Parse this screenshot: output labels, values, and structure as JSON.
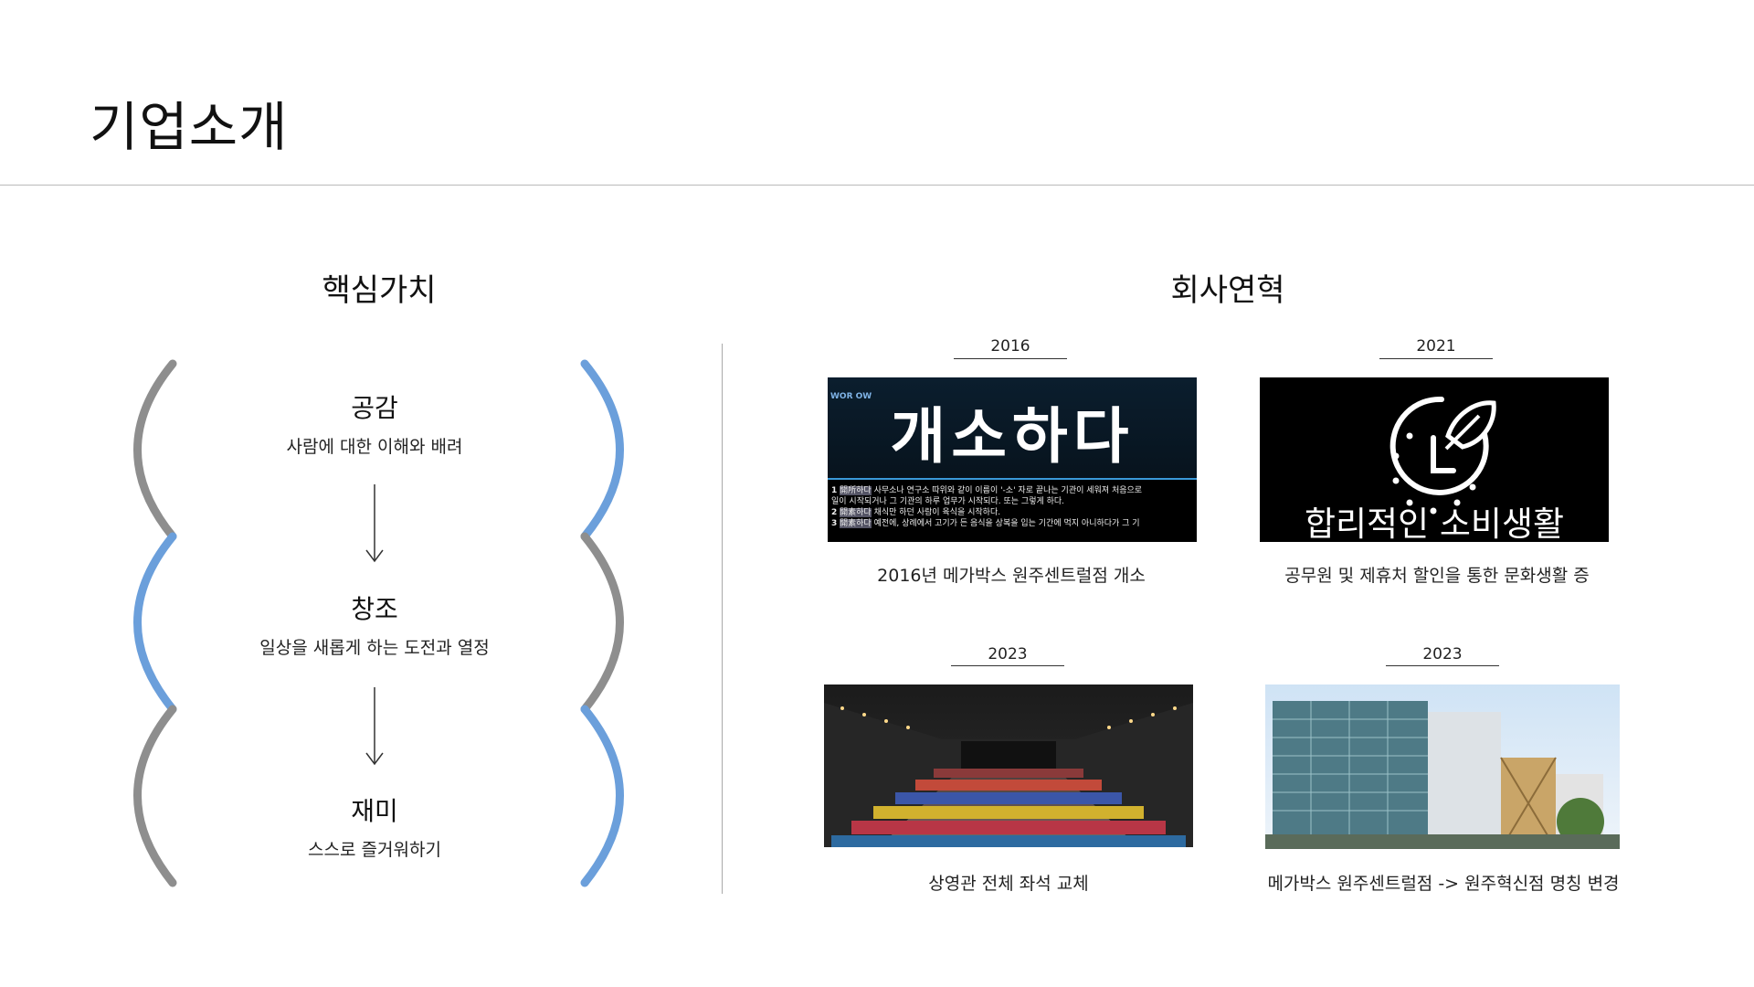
{
  "page": {
    "title": "기업소개"
  },
  "core_values": {
    "heading": "핵심가치",
    "items": [
      {
        "name": "공감",
        "desc": "사람에 대한 이해와 배려"
      },
      {
        "name": "창조",
        "desc": "일상을 새롭게 하는 도전과 열정"
      },
      {
        "name": "재미",
        "desc": "스스로 즐거워하기"
      }
    ]
  },
  "history": {
    "heading": "회사연혁",
    "entries": [
      {
        "year": "2016",
        "caption": "2016년 메가박스 원주센트럴점 개소",
        "image": {
          "logo": "WOR OW",
          "headline": "개소하다",
          "definitions": [
            {
              "num": "1",
              "tag": "開所하다",
              "text": "사무소나 연구소 따위와 같이 이름이 '-소' 자로 끝나는 기관이 세워져 처음으로"
            },
            {
              "num": "",
              "tag": "",
              "text": "일이 시작되거나 그 기관의 하루 업무가 시작되다. 또는 그렇게 하다."
            },
            {
              "num": "2",
              "tag": "開素하다",
              "text": "채식만 하던 사람이 육식을 시작하다."
            },
            {
              "num": "3",
              "tag": "開素하다",
              "text": "예전에, 상례에서 고기가 든 음식을 상복을 입는 기간에 먹지 아니하다가 그 기"
            }
          ]
        }
      },
      {
        "year": "2021",
        "caption": "공무원 및 제휴처 할인을 통한 문화생활 증",
        "image": {
          "icon": "clock-leaf-icon",
          "text": "합리적인 소비생활"
        }
      },
      {
        "year": "2023",
        "caption": "상영관 전체 좌석 교체",
        "image": {
          "subject": "theater-seats-photo"
        }
      },
      {
        "year": "2023",
        "caption": "메가박스 원주센트럴점 -> 원주혁신점 명칭 변경",
        "image": {
          "subject": "building-photo"
        }
      }
    ]
  },
  "colors": {
    "gray": "#8e8e8e",
    "blue": "#6b9fdb"
  }
}
